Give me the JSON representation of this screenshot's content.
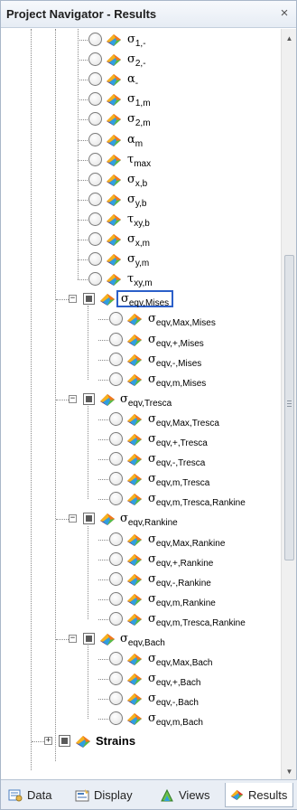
{
  "window": {
    "title": "Project Navigator - Results",
    "close_label": "×"
  },
  "tree": {
    "plain_items": [
      {
        "sym": "σ",
        "sub": "1,-"
      },
      {
        "sym": "σ",
        "sub": "2,-"
      },
      {
        "sym": "α",
        "sub": "-"
      },
      {
        "sym": "σ",
        "sub": "1,m"
      },
      {
        "sym": "σ",
        "sub": "2,m"
      },
      {
        "sym": "α",
        "sub": "m"
      },
      {
        "sym": "τ",
        "sub": "max"
      },
      {
        "sym": "σ",
        "sub": "x,b"
      },
      {
        "sym": "σ",
        "sub": "y,b"
      },
      {
        "sym": "τ",
        "sub": "xy,b"
      },
      {
        "sym": "σ",
        "sub": "x,m"
      },
      {
        "sym": "σ",
        "sub": "y,m"
      },
      {
        "sym": "τ",
        "sub": "xy,m"
      }
    ],
    "groups": [
      {
        "header": {
          "sym": "σ",
          "sub": "eqv,Mises"
        },
        "selected": true,
        "children": [
          {
            "sym": "σ",
            "sub": "eqv,Max,Mises"
          },
          {
            "sym": "σ",
            "sub": "eqv,+,Mises"
          },
          {
            "sym": "σ",
            "sub": "eqv,-,Mises"
          },
          {
            "sym": "σ",
            "sub": "eqv,m,Mises"
          }
        ]
      },
      {
        "header": {
          "sym": "σ",
          "sub": "eqv,Tresca"
        },
        "selected": false,
        "children": [
          {
            "sym": "σ",
            "sub": "eqv,Max,Tresca"
          },
          {
            "sym": "σ",
            "sub": "eqv,+,Tresca"
          },
          {
            "sym": "σ",
            "sub": "eqv,-,Tresca"
          },
          {
            "sym": "σ",
            "sub": "eqv,m,Tresca"
          },
          {
            "sym": "σ",
            "sub": "eqv,m,Tresca,Rankine"
          }
        ]
      },
      {
        "header": {
          "sym": "σ",
          "sub": "eqv,Rankine"
        },
        "selected": false,
        "children": [
          {
            "sym": "σ",
            "sub": "eqv,Max,Rankine"
          },
          {
            "sym": "σ",
            "sub": "eqv,+,Rankine"
          },
          {
            "sym": "σ",
            "sub": "eqv,-,Rankine"
          },
          {
            "sym": "σ",
            "sub": "eqv,m,Rankine"
          },
          {
            "sym": "σ",
            "sub": "eqv,m,Tresca,Rankine"
          }
        ]
      },
      {
        "header": {
          "sym": "σ",
          "sub": "eqv,Bach"
        },
        "selected": false,
        "children": [
          {
            "sym": "σ",
            "sub": "eqv,Max,Bach"
          },
          {
            "sym": "σ",
            "sub": "eqv,+,Bach"
          },
          {
            "sym": "σ",
            "sub": "eqv,-,Bach"
          },
          {
            "sym": "σ",
            "sub": "eqv,m,Bach"
          }
        ]
      }
    ],
    "strains_label": "Strains",
    "expand_minus": "−",
    "expand_plus": "+"
  },
  "tabs": [
    {
      "label": "Data",
      "icon": "data-icon"
    },
    {
      "label": "Display",
      "icon": "display-icon"
    },
    {
      "label": "Views",
      "icon": "views-icon"
    },
    {
      "label": "Results",
      "icon": "results-icon",
      "active": true
    }
  ],
  "scroll": {
    "up_glyph": "▲",
    "down_glyph": "▼"
  }
}
